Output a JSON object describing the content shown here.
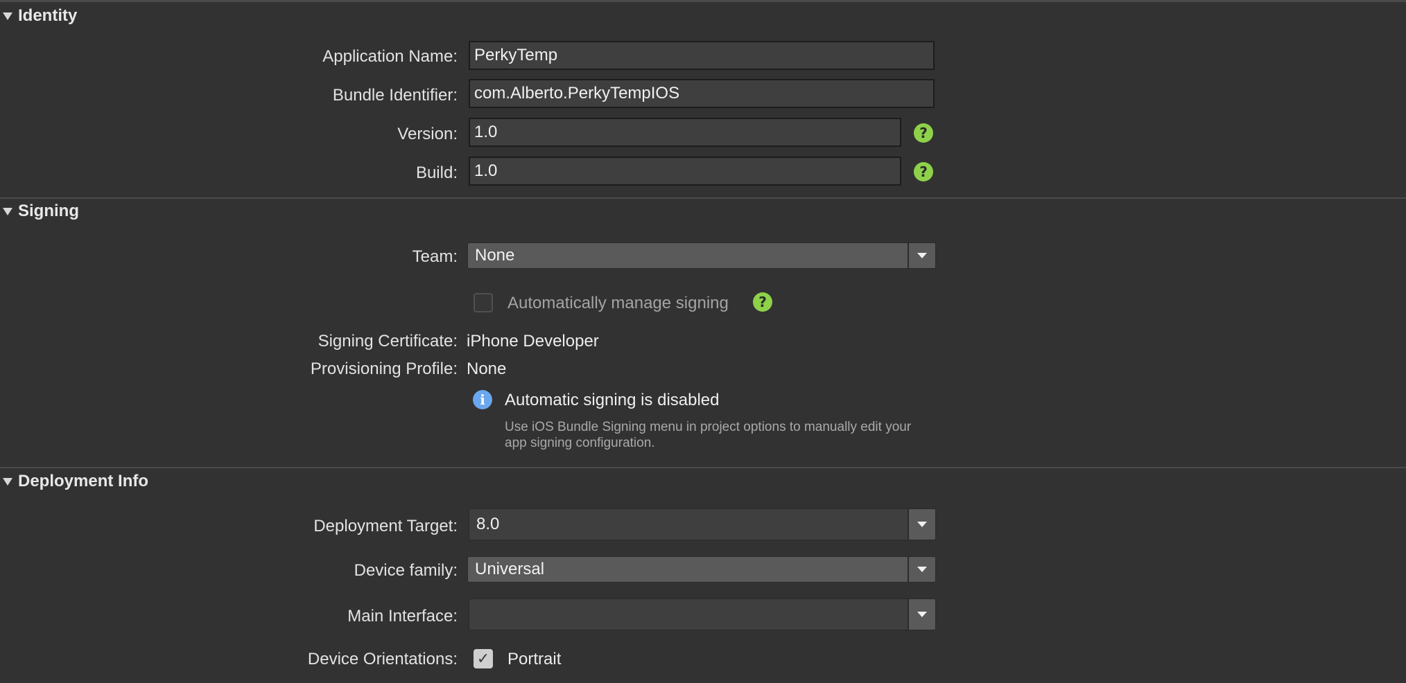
{
  "identity": {
    "header": "Identity",
    "app_name_label": "Application Name:",
    "app_name_value": "PerkyTemp",
    "bundle_label": "Bundle Identifier:",
    "bundle_value": "com.Alberto.PerkyTempIOS",
    "version_label": "Version:",
    "version_value": "1.0",
    "build_label": "Build:",
    "build_value": "1.0",
    "help_glyph": "?"
  },
  "signing": {
    "header": "Signing",
    "team_label": "Team:",
    "team_value": "None",
    "auto_manage_label": "Automatically manage signing",
    "cert_label": "Signing Certificate:",
    "cert_value": "iPhone Developer",
    "profile_label": "Provisioning Profile:",
    "profile_value": "None",
    "info_glyph": "i",
    "info_title": "Automatic signing is disabled",
    "info_desc": "Use iOS Bundle Signing menu in project options to manually edit your app signing configuration."
  },
  "deployment": {
    "header": "Deployment Info",
    "target_label": "Deployment Target:",
    "target_value": "8.0",
    "family_label": "Device family:",
    "family_value": "Universal",
    "main_interface_label": "Main Interface:",
    "main_interface_value": "",
    "orientations_label": "Device Orientations:",
    "portrait_label": "Portrait",
    "check_glyph": "✓"
  },
  "icons": {
    "disclosure": "disclosure-triangle-icon",
    "help": "help-icon",
    "info": "info-icon",
    "dropdown": "chevron-down-icon"
  },
  "colors": {
    "background": "#323232",
    "help_icon": "#8ed24a",
    "info_icon": "#6aa7ef"
  }
}
